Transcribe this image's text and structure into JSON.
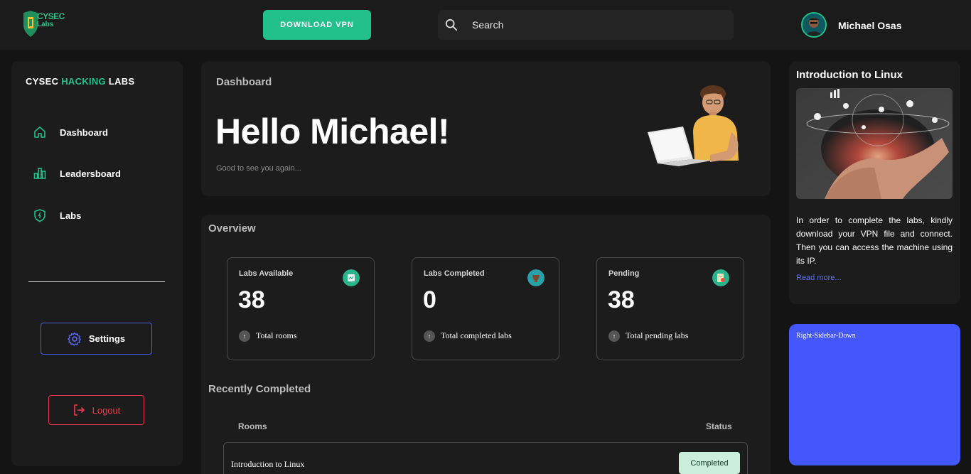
{
  "topbar": {
    "logo_line1": "CYSEC",
    "logo_line2": "Labs",
    "download_vpn": "DOWNLOAD VPN",
    "search_placeholder": "Search",
    "user_name": "Michael Osas"
  },
  "sidebar": {
    "brand_part1": "CYSEC ",
    "brand_part2": "HACKING",
    "brand_part3": " LABS",
    "items": [
      {
        "label": "Dashboard",
        "icon": "home-icon"
      },
      {
        "label": "Leadersboard",
        "icon": "bar-chart-icon"
      },
      {
        "label": "Labs",
        "icon": "shield-icon"
      }
    ],
    "settings": "Settings",
    "logout": "Logout"
  },
  "hero": {
    "label": "Dashboard",
    "title": "Hello Michael!",
    "subtitle": "Good to see you again..."
  },
  "overview": {
    "title": "Overview",
    "cards": [
      {
        "label": "Labs Available",
        "value": "38",
        "caption": "Total rooms",
        "icon_color": "#2bb38a"
      },
      {
        "label": "Labs Completed",
        "value": "0",
        "caption": "Total completed labs",
        "icon_color": "#2aa0a8"
      },
      {
        "label": "Pending",
        "value": "38",
        "caption": "Total pending labs",
        "icon_color": "#2bb38a"
      }
    ],
    "trend_glyph": "↑"
  },
  "recent": {
    "title": "Recently Completed",
    "col_rooms": "Rooms",
    "col_status": "Status",
    "rows": [
      {
        "room": "Introduction to Linux",
        "status": "Completed"
      }
    ]
  },
  "right": {
    "title": "Introduction to Linux",
    "text": "In order to complete the labs, kindly download your VPN file and connect. Then you can access the machine using its IP.",
    "read_more": "Read more...",
    "down_label": "Right-Sidebar-Down"
  },
  "colors": {
    "accent_green": "#22c08b",
    "settings_border": "#4a5cf0",
    "logout_red": "#e0344c",
    "right_panel_blue": "#4457fb",
    "badge_bg": "#c9eedb"
  }
}
